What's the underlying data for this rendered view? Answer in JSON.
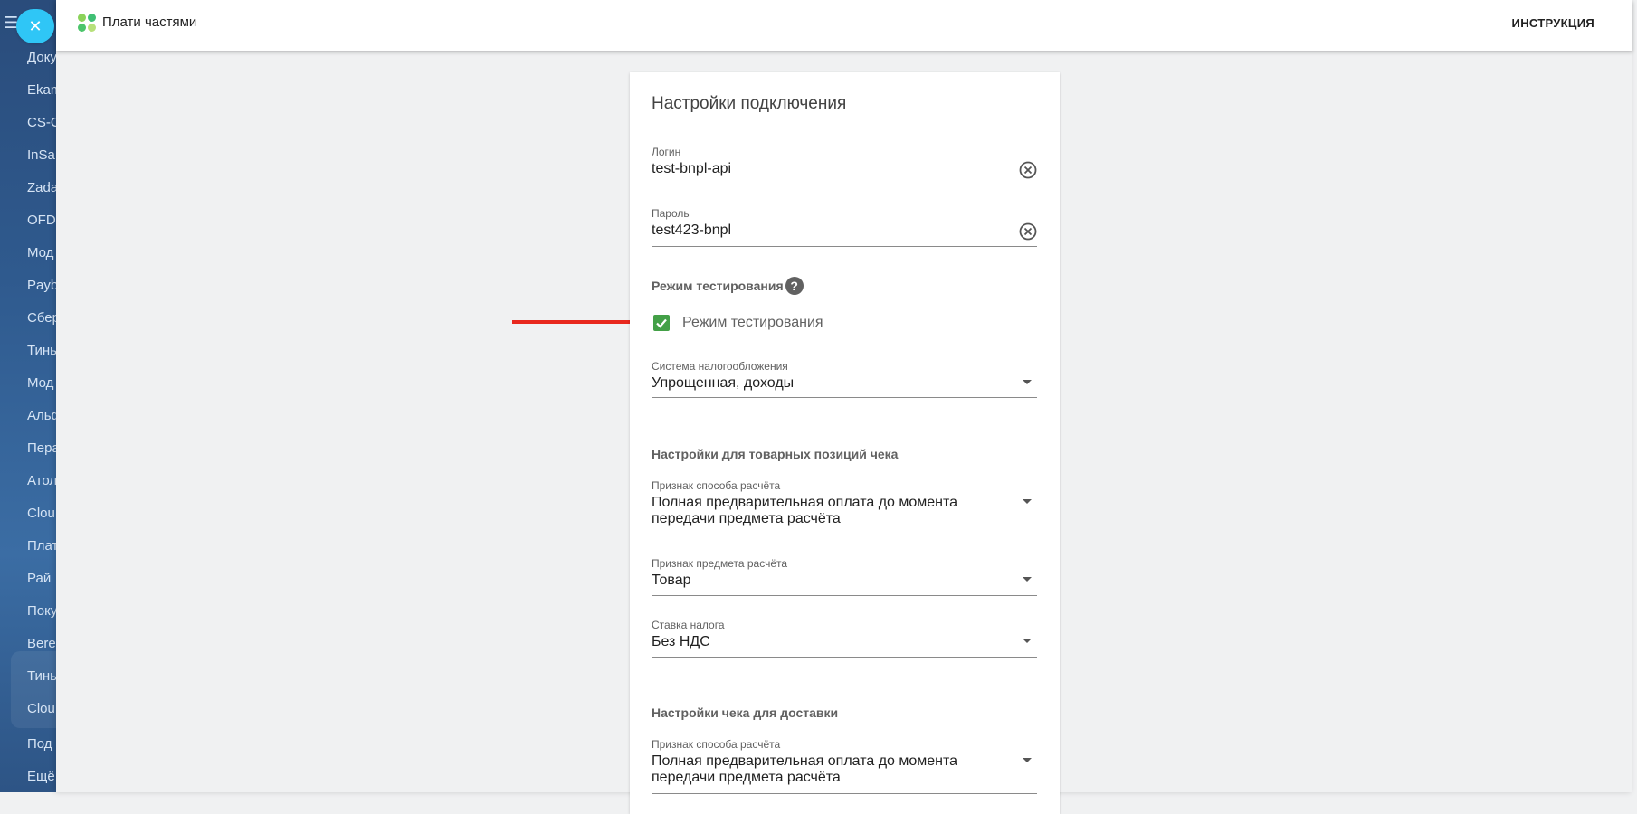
{
  "background_sidebar": {
    "menu_icon": "hamburger-menu-icon",
    "items": [
      "Доку",
      "Ekam",
      "CS-C",
      "InSa",
      "Zada",
      "OFD",
      "Мод",
      "Payb",
      "Сбер",
      "Тинь",
      "Мод",
      "Альф",
      "Пера",
      "Атол",
      "Clou",
      "Плат",
      "Рай",
      "Поку",
      "Bere",
      "Тинь",
      "Clou",
      "Под",
      "Ещё"
    ]
  },
  "close_button": {
    "icon": "close-icon"
  },
  "header": {
    "title": "Плати частями",
    "instruction_label": "ИНСТРУКЦИЯ"
  },
  "form": {
    "section_title": "Настройки подключения",
    "login": {
      "label": "Логин",
      "value": "test-bnpl-api"
    },
    "password": {
      "label": "Пароль",
      "value": "test423-bnpl"
    },
    "test_mode": {
      "heading": "Режим тестирования",
      "checkbox_label": "Режим тестирования",
      "checked": true
    },
    "tax_system": {
      "label": "Система налогообложения",
      "value": "Упрощенная, доходы"
    },
    "item_settings_heading": "Настройки для товарных позиций чека",
    "payment_method": {
      "label": "Признак способа расчёта",
      "value": "Полная предварительная оплата до момента передачи предмета расчёта"
    },
    "payment_subject": {
      "label": "Признак предмета расчёта",
      "value": "Товар"
    },
    "vat_rate": {
      "label": "Ставка налога",
      "value": "Без НДС"
    },
    "delivery_settings_heading": "Настройки чека для доставки",
    "delivery_payment_method": {
      "label": "Признак способа расчёта",
      "value": "Полная предварительная оплата до момента передачи предмета расчёта"
    }
  },
  "colors": {
    "accent_close": "#2fc6f6",
    "checkbox": "#43a047",
    "annotation": "#e8281e"
  }
}
